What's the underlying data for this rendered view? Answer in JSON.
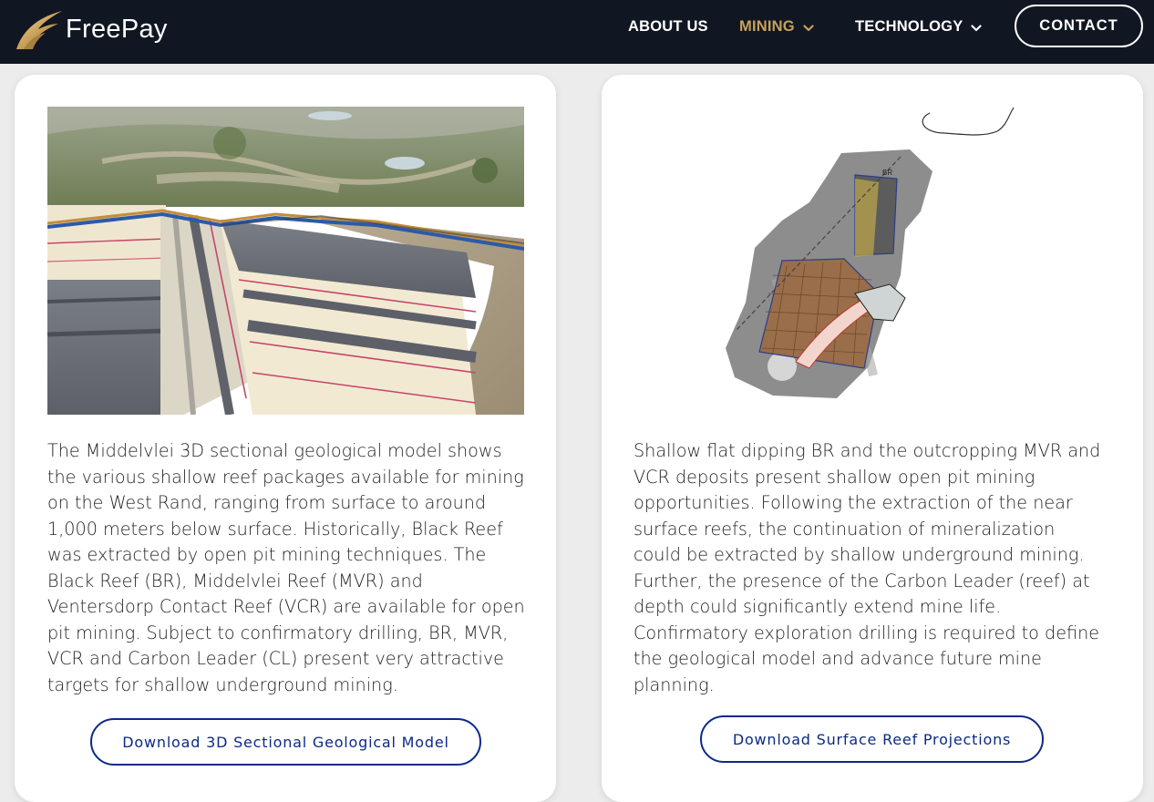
{
  "brand": {
    "name": "FreePay",
    "logo_color": "#c9a15a"
  },
  "nav": {
    "items": [
      {
        "label": "ABOUT US"
      },
      {
        "label": "MINING"
      },
      {
        "label": "TECHNOLOGY"
      }
    ],
    "active_index": 1,
    "contact_label": "CONTACT",
    "active_color": "#c9a15a"
  },
  "cards": [
    {
      "image_icon": "geological-model-image",
      "text": "The Middelvlei 3D sectional geological model shows the various shallow reef packages available for mining on the West Rand, ranging from surface to around 1,000 meters below surface. Historically, Black Reef was extracted by open pit mining techniques. The Black Reef (BR), Middelvlei Reef (MVR) and Ventersdorp Contact Reef (VCR) are available for open pit mining. Subject to confirmatory drilling, BR, MVR, VCR and Carbon Leader (CL) present very attractive targets for shallow underground mining.",
      "button_label": "Download 3D Sectional Geological Model"
    },
    {
      "image_icon": "surface-reef-map-image",
      "map_label": "BR",
      "text": "Shallow flat dipping BR and the outcropping MVR and VCR deposits present shallow open pit mining opportunities. Following the extraction of the near surface reefs, the continuation of mineralization could be extracted by shallow underground mining. Further, the presence of the Carbon Leader (reef) at depth could significantly extend mine life. Confirmatory exploration drilling is required to define the geological model and advance future mine planning.",
      "button_label": "Download Surface Reef Projections"
    }
  ],
  "colors": {
    "navbar_bg": "#111722",
    "button_border": "#0c2a86"
  }
}
